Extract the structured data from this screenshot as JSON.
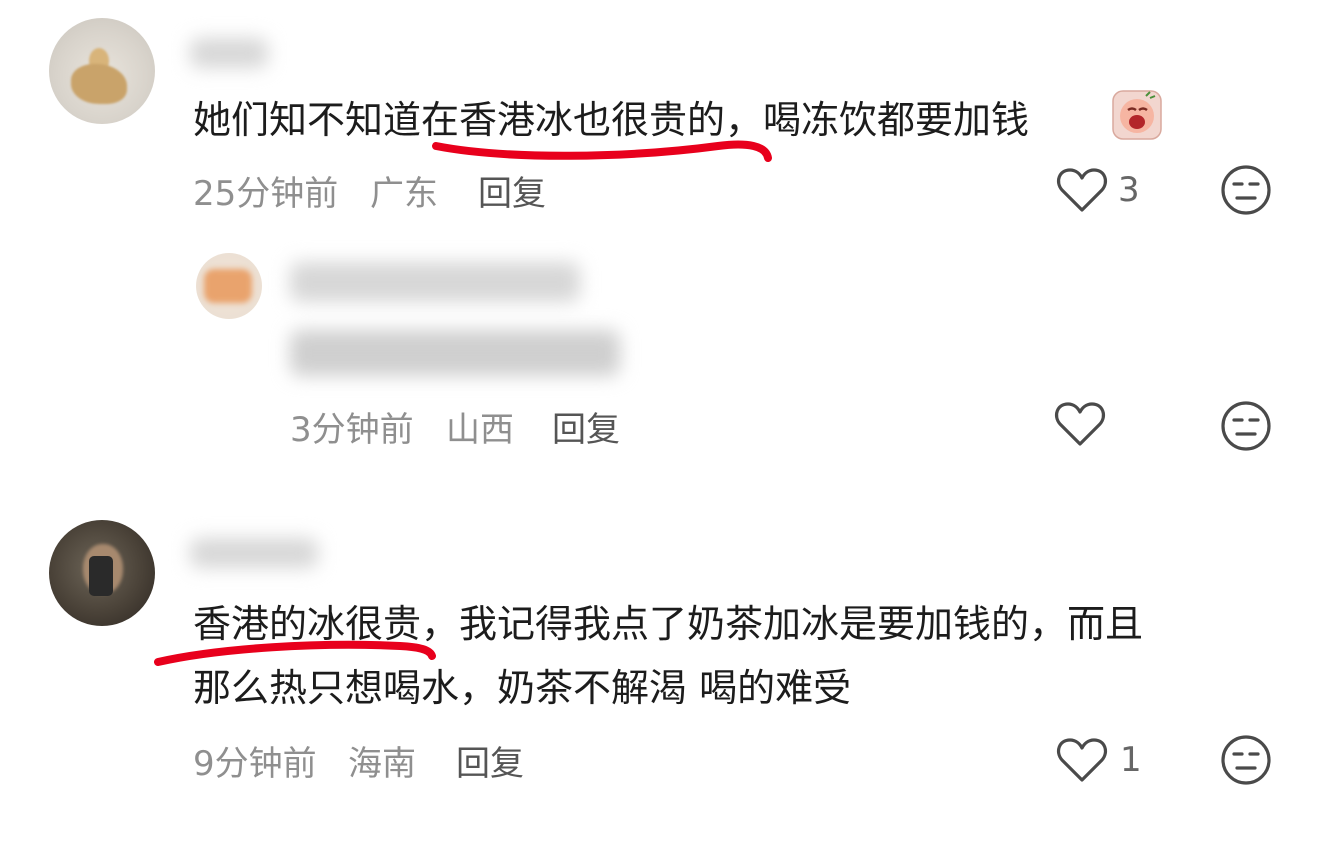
{
  "comments": [
    {
      "avatar": "user-avatar-figurine",
      "text": "她们知不知道在香港冰也很贵的，喝冻饮都要加钱",
      "sticker": "crying-face-sticker",
      "time": "25分钟前",
      "location": "广东",
      "reply_label": "回复",
      "like_count": "3",
      "replies": [
        {
          "avatar": "user-avatar-orange",
          "time": "3分钟前",
          "location": "山西",
          "reply_label": "回复",
          "like_count": ""
        }
      ]
    },
    {
      "avatar": "user-avatar-selfie",
      "text_line1": "香港的冰很贵，我记得我点了奶茶加冰是要加钱的，而且",
      "text_line2": "那么热只想喝水，奶茶不解渴 喝的难受",
      "time": "9分钟前",
      "location": "海南",
      "reply_label": "回复",
      "like_count": "1"
    }
  ],
  "icons": {
    "like": "heart-outline-icon",
    "dislike": "unamused-face-icon"
  },
  "colors": {
    "underline": "#e8001c",
    "meta_text": "#8f8f8f",
    "body_text": "#1c1c1c"
  }
}
